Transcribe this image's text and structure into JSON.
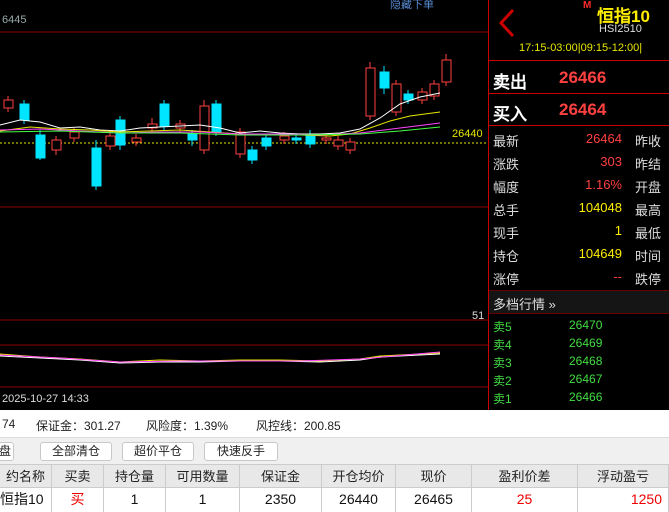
{
  "chart": {
    "top_price_label": "6445",
    "hide_order_label": "隐藏下单",
    "current_price_label": "26440",
    "volume_label": "51",
    "date_label": "2025-10-27 14:33"
  },
  "header": {
    "badge": "M",
    "name": "恒指10",
    "code": "HSI2510",
    "session": "17:15-03:00|09:15-12:00|"
  },
  "quote": {
    "sell_label": "卖出",
    "sell_value": "26466",
    "buy_label": "买入",
    "buy_value": "26464"
  },
  "stats": [
    {
      "label": "最新",
      "value": "26464",
      "label2": "昨收",
      "color": "red"
    },
    {
      "label": "涨跌",
      "value": "303",
      "label2": "昨结",
      "color": "red"
    },
    {
      "label": "幅度",
      "value": "1.16%",
      "label2": "开盘",
      "color": "red"
    },
    {
      "label": "总手",
      "value": "104048",
      "label2": "最高",
      "color": "yellow"
    },
    {
      "label": "现手",
      "value": "1",
      "label2": "最低",
      "color": "yellow"
    },
    {
      "label": "持仓",
      "value": "104649",
      "label2": "时间",
      "color": "yellow"
    },
    {
      "label": "涨停",
      "value": "--",
      "label2": "跌停",
      "color": "red"
    }
  ],
  "depth": {
    "title": "多档行情",
    "rows": [
      {
        "label": "卖5",
        "value": "26470"
      },
      {
        "label": "卖4",
        "value": "26469"
      },
      {
        "label": "卖3",
        "value": "26468"
      },
      {
        "label": "卖2",
        "value": "26467"
      },
      {
        "label": "卖1",
        "value": "26466"
      }
    ]
  },
  "account": {
    "item1": "74",
    "margin": "保证金：301.27",
    "risk": "风险度：1.39%",
    "risk_line": "风控线：200.85"
  },
  "buttons": {
    "tab": "盘",
    "close_all": "全部清仓",
    "super_close": "超价平仓",
    "quick_reverse": "快速反手"
  },
  "table": {
    "headers": [
      "约名称",
      "买卖",
      "持仓量",
      "可用数量",
      "保证金",
      "开仓均价",
      "现价",
      "盈利价差",
      "浮动盈亏"
    ],
    "row": [
      "恒指10",
      "买",
      "1",
      "1",
      "2350",
      "26440",
      "26465",
      "25",
      "1250"
    ]
  },
  "colors": {
    "up": "#ff4040",
    "down": "#00e5ff",
    "frame": "#c00000"
  }
}
